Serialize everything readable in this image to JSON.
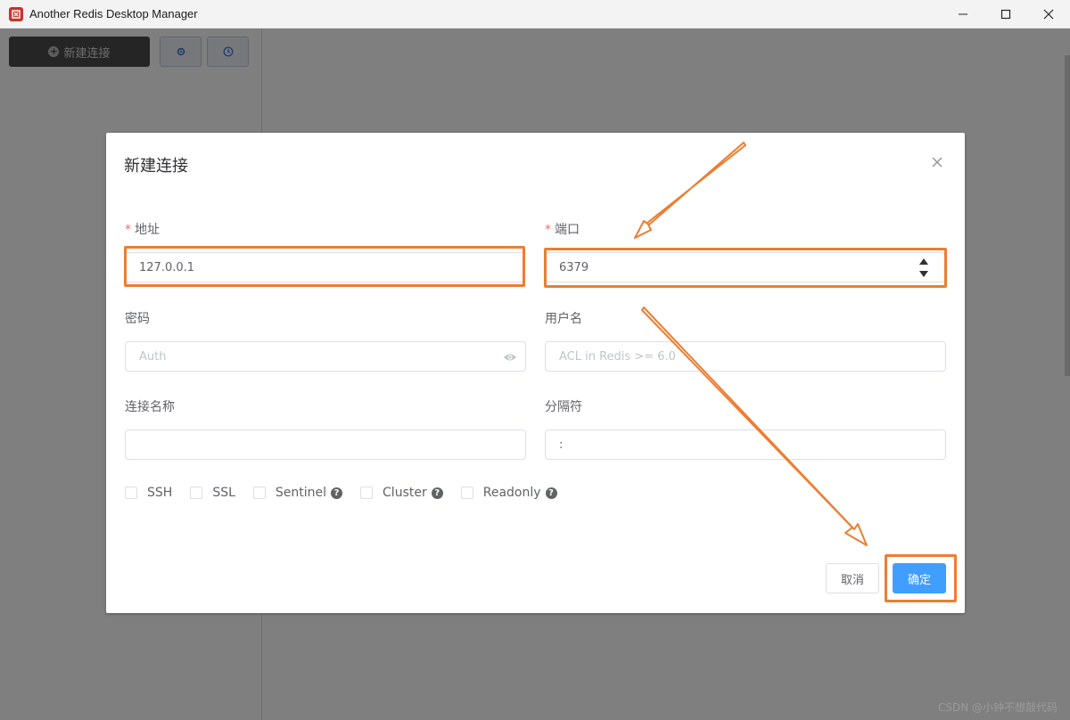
{
  "window": {
    "title": "Another Redis Desktop Manager"
  },
  "sidebar": {
    "new_connection_label": "新建连接"
  },
  "dialog": {
    "title": "新建连接",
    "required_mark": "*",
    "fields": {
      "host": {
        "label": "地址",
        "value": "127.0.0.1"
      },
      "port": {
        "label": "端口",
        "value": "6379"
      },
      "password": {
        "label": "密码",
        "placeholder": "Auth"
      },
      "username": {
        "label": "用户名",
        "placeholder": "ACL in Redis >= 6.0"
      },
      "connection_name": {
        "label": "连接名称",
        "value": ""
      },
      "separator": {
        "label": "分隔符",
        "value": ":"
      }
    },
    "options": [
      {
        "label": "SSH",
        "has_help": false
      },
      {
        "label": "SSL",
        "has_help": false
      },
      {
        "label": "Sentinel",
        "has_help": true
      },
      {
        "label": "Cluster",
        "has_help": true
      },
      {
        "label": "Readonly",
        "has_help": true
      }
    ],
    "help_glyph": "?",
    "cancel_label": "取消",
    "ok_label": "确定"
  },
  "watermark": "CSDN @小钟不想敲代码",
  "colors": {
    "annotation": "#ed7d31",
    "primary": "#409eff",
    "required": "#f56c6c"
  }
}
